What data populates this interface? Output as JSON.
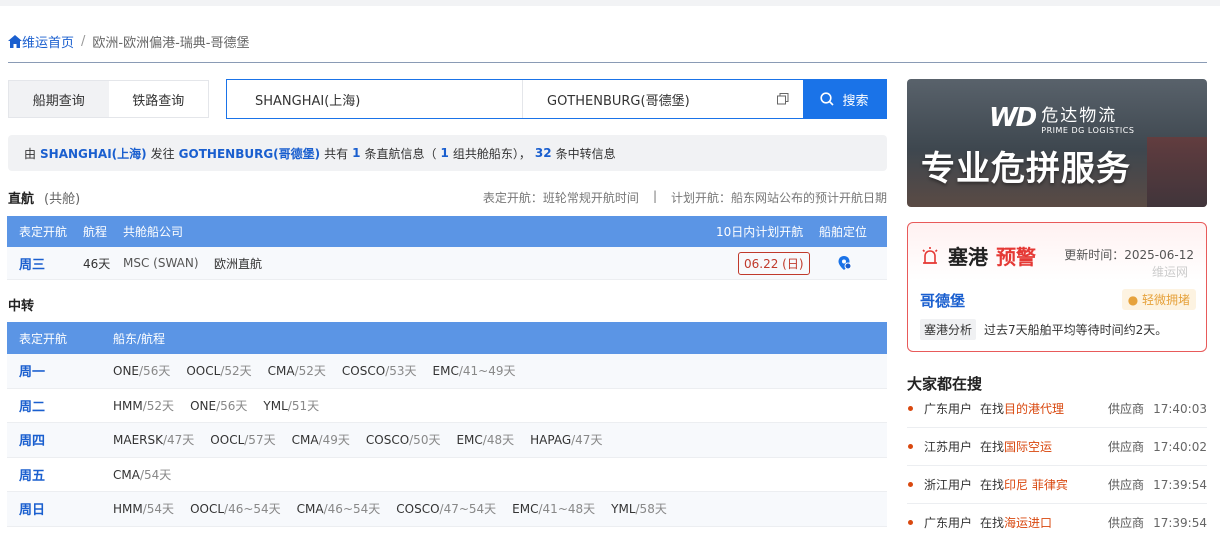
{
  "breadcrumb": {
    "home": "维运首页",
    "separator": "/",
    "current": "欧洲-欧洲偏港-瑞典-哥德堡"
  },
  "tabs": [
    {
      "label": "船期查询",
      "active": true
    },
    {
      "label": "铁路查询",
      "active": false
    }
  ],
  "search": {
    "origin": "SHANGHAI(上海)",
    "destination": "GOTHENBURG(哥德堡)",
    "button": "搜索"
  },
  "summary": {
    "p1": "由",
    "origin": "SHANGHAI(上海)",
    "p2": "发往",
    "destination": "GOTHENBURG(哥德堡)",
    "p3": "共有",
    "direct_count": "1",
    "p4": "条直航信息（",
    "group_count": "1",
    "p5": "组共舱船东），",
    "transfer_count": "32",
    "p6": "条中转信息"
  },
  "direct": {
    "title": "直航",
    "subtitle": "(共舱)",
    "note_left": "表定开航：班轮常规开航时间",
    "note_sep": "|",
    "note_right": "计划开航：船东网站公布的预计开航日期",
    "headers": {
      "day": "表定开航",
      "duration": "航程",
      "carrier": "共舱船公司",
      "plan": "10日内计划开航",
      "locate": "船舶定位"
    },
    "rows": [
      {
        "day": "周三",
        "duration": "46天",
        "carrier": "MSC (SWAN)",
        "service": "欧洲直航",
        "plan": "06.22 (日)"
      }
    ]
  },
  "transfer": {
    "title": "中转",
    "headers": {
      "day": "表定开航",
      "carriers": "船东/航程"
    },
    "rows": [
      {
        "day": "周一",
        "carriers": [
          {
            "name": "ONE",
            "days": "/56天"
          },
          {
            "name": "OOCL",
            "days": "/52天"
          },
          {
            "name": "CMA",
            "days": "/52天"
          },
          {
            "name": "COSCO",
            "days": "/53天"
          },
          {
            "name": "EMC",
            "days": "/41~49天"
          }
        ]
      },
      {
        "day": "周二",
        "carriers": [
          {
            "name": "HMM",
            "days": "/52天"
          },
          {
            "name": "ONE",
            "days": "/56天"
          },
          {
            "name": "YML",
            "days": "/51天"
          }
        ]
      },
      {
        "day": "周四",
        "carriers": [
          {
            "name": "MAERSK",
            "days": "/47天"
          },
          {
            "name": "OOCL",
            "days": "/57天"
          },
          {
            "name": "CMA",
            "days": "/49天"
          },
          {
            "name": "COSCO",
            "days": "/50天"
          },
          {
            "name": "EMC",
            "days": "/48天"
          },
          {
            "name": "HAPAG",
            "days": "/47天"
          }
        ]
      },
      {
        "day": "周五",
        "carriers": [
          {
            "name": "CMA",
            "days": "/54天"
          }
        ]
      },
      {
        "day": "周日",
        "carriers": [
          {
            "name": "HMM",
            "days": "/54天"
          },
          {
            "name": "OOCL",
            "days": "/46~54天"
          },
          {
            "name": "CMA",
            "days": "/46~54天"
          },
          {
            "name": "COSCO",
            "days": "/47~54天"
          },
          {
            "name": "EMC",
            "days": "/41~48天"
          },
          {
            "name": "YML",
            "days": "/58天"
          }
        ]
      }
    ]
  },
  "banner": {
    "logo_mark": "WD",
    "logo_name": "危达物流",
    "logo_en": "PRIME DG LOGISTICS",
    "slogan": "专业危拼服务"
  },
  "alert": {
    "title_a": "塞港",
    "title_b": "预警",
    "update": "更新时间：2025-06-12",
    "watermark": "维运网",
    "city": "哥德堡",
    "level": "轻微拥堵",
    "analysis_tag": "塞港分析",
    "analysis_text": "过去7天船舶平均等待时间约2天。"
  },
  "hot": {
    "title": "大家都在搜",
    "items": [
      {
        "who": "广东用户",
        "find": "在找",
        "kw": "目的港代理",
        "role": "供应商",
        "time": "17:40:03"
      },
      {
        "who": "江苏用户",
        "find": "在找",
        "kw": "国际空运",
        "role": "供应商",
        "time": "17:40:02"
      },
      {
        "who": "浙江用户",
        "find": "在找",
        "kw": "印尼 菲律宾",
        "role": "供应商",
        "time": "17:39:54"
      },
      {
        "who": "广东用户",
        "find": "在找",
        "kw": "海运进口",
        "role": "供应商",
        "time": "17:39:54"
      }
    ]
  },
  "colors": {
    "accent": "#1a73e8",
    "link": "#1a5fcf",
    "header": "#5b95e5",
    "warn": "#e53935",
    "orange": "#d9480f"
  }
}
